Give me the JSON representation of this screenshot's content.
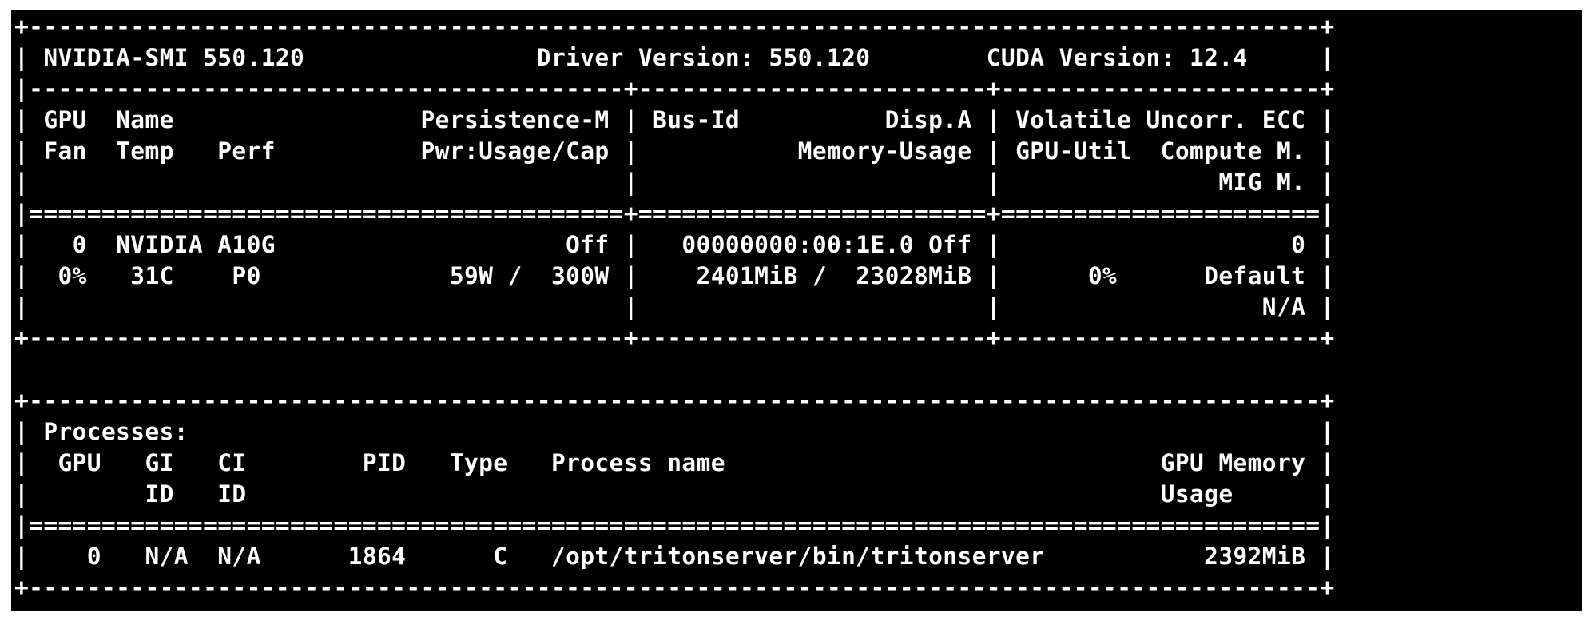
{
  "lines": [
    "+-----------------------------------------------------------------------------------------+",
    "| NVIDIA-SMI 550.120                Driver Version: 550.120        CUDA Version: 12.4     |",
    "|-----------------------------------------+------------------------+----------------------+",
    "| GPU  Name                 Persistence-M | Bus-Id          Disp.A | Volatile Uncorr. ECC |",
    "| Fan  Temp   Perf          Pwr:Usage/Cap |           Memory-Usage | GPU-Util  Compute M. |",
    "|                                         |                        |               MIG M. |",
    "|=========================================+========================+======================|",
    "|   0  NVIDIA A10G                    Off |   00000000:00:1E.0 Off |                    0 |",
    "|  0%   31C    P0             59W /  300W |    2401MiB /  23028MiB |      0%      Default |",
    "|                                         |                        |                  N/A |",
    "+-----------------------------------------+------------------------+----------------------+",
    "",
    "+-----------------------------------------------------------------------------------------+",
    "| Processes:                                                                              |",
    "|  GPU   GI   CI        PID   Type   Process name                              GPU Memory |",
    "|        ID   ID                                                               Usage      |",
    "|=========================================================================================|",
    "|    0   N/A  N/A      1864      C   /opt/tritonserver/bin/tritonserver           2392MiB |",
    "+-----------------------------------------------------------------------------------------+"
  ],
  "colors": {
    "background": "#000000",
    "text": "#ffffff"
  }
}
